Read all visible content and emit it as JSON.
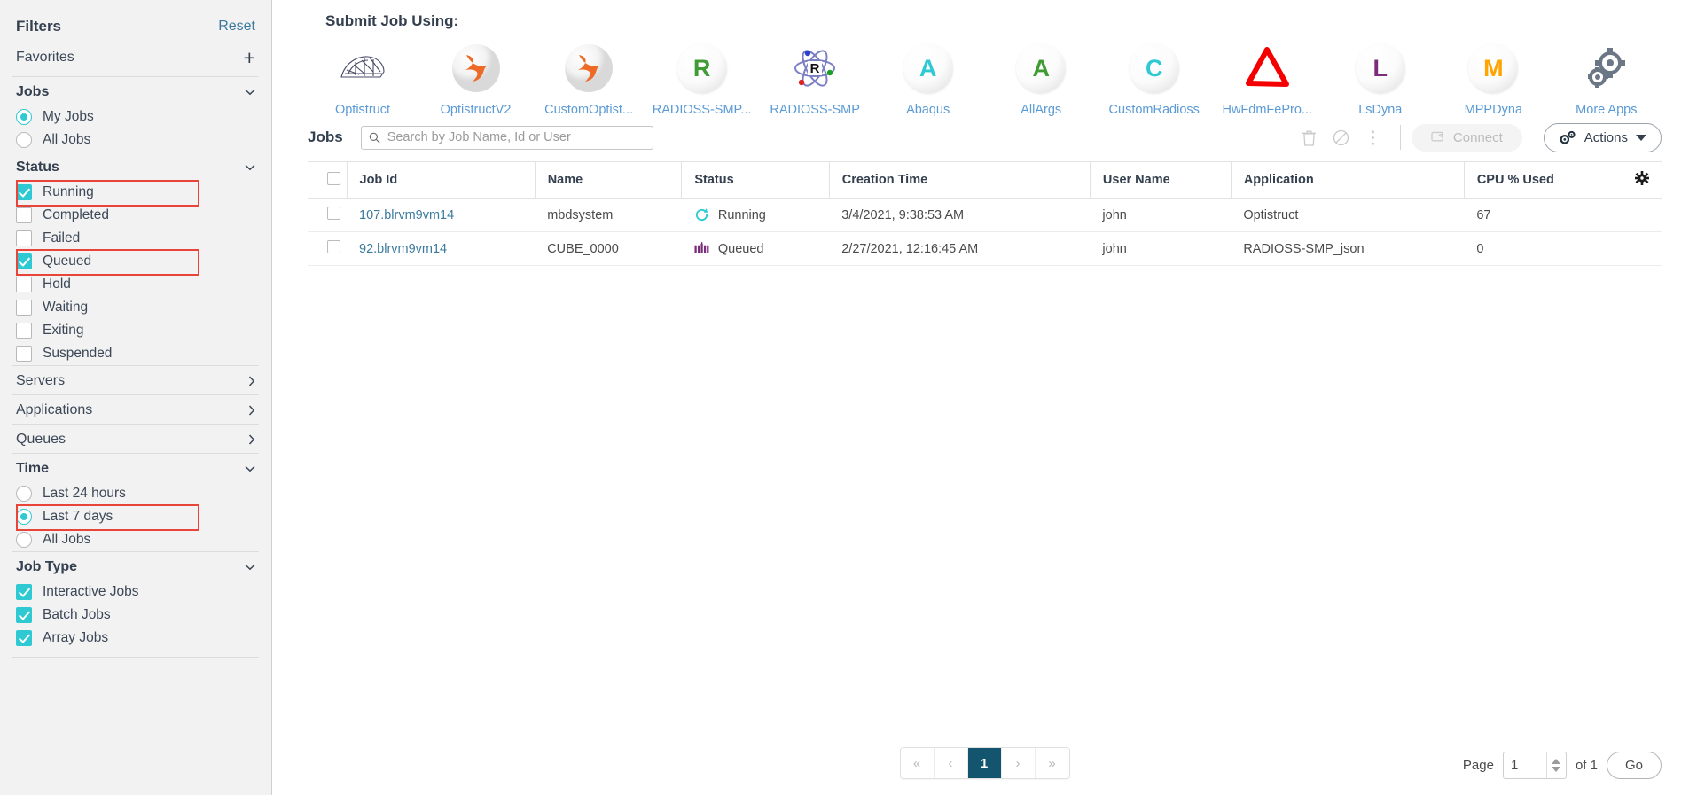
{
  "sidebar": {
    "title": "Filters",
    "reset_label": "Reset",
    "favorites_label": "Favorites",
    "add_icon": "plus-icon",
    "sections": [
      {
        "title": "Jobs",
        "type": "radio",
        "expanded": true,
        "options": [
          {
            "label": "My Jobs",
            "selected": true
          },
          {
            "label": "All Jobs",
            "selected": false
          }
        ]
      },
      {
        "title": "Status",
        "type": "checkbox",
        "expanded": true,
        "options": [
          {
            "label": "Running",
            "checked": true,
            "highlighted": true
          },
          {
            "label": "Completed",
            "checked": false,
            "highlighted": false
          },
          {
            "label": "Failed",
            "checked": false,
            "highlighted": false
          },
          {
            "label": "Queued",
            "checked": true,
            "highlighted": true
          },
          {
            "label": "Hold",
            "checked": false,
            "highlighted": false
          },
          {
            "label": "Waiting",
            "checked": false,
            "highlighted": false
          },
          {
            "label": "Exiting",
            "checked": false,
            "highlighted": false
          },
          {
            "label": "Suspended",
            "checked": false,
            "highlighted": false
          }
        ]
      },
      {
        "title": "Servers",
        "type": "collapsed",
        "expanded": false,
        "options": []
      },
      {
        "title": "Applications",
        "type": "collapsed",
        "expanded": false,
        "options": []
      },
      {
        "title": "Queues",
        "type": "collapsed",
        "expanded": false,
        "options": []
      },
      {
        "title": "Time",
        "type": "radio",
        "expanded": true,
        "options": [
          {
            "label": "Last 24 hours",
            "selected": false,
            "highlighted": false
          },
          {
            "label": "Last 7 days",
            "selected": true,
            "highlighted": true
          },
          {
            "label": "All Jobs",
            "selected": false,
            "highlighted": false
          }
        ]
      },
      {
        "title": "Job Type",
        "type": "checkbox",
        "expanded": true,
        "options": [
          {
            "label": "Interactive Jobs",
            "checked": true,
            "highlighted": false
          },
          {
            "label": "Batch Jobs",
            "checked": true,
            "highlighted": false
          },
          {
            "label": "Array Jobs",
            "checked": true,
            "highlighted": false
          }
        ]
      }
    ]
  },
  "submit": {
    "title": "Submit Job Using:",
    "apps": [
      {
        "label": "Optistruct",
        "icon": "mesh-structure-icon",
        "kind": "mesh",
        "color": "#4a4a6a"
      },
      {
        "label": "OptistructV2",
        "icon": "altair-h-icon",
        "kind": "altair",
        "color": "#ed6b26"
      },
      {
        "label": "CustomOptist...",
        "icon": "altair-h-icon",
        "kind": "altair",
        "color": "#ed6b26"
      },
      {
        "label": "RADIOSS-SMP...",
        "icon": "letter-r-icon",
        "kind": "letter",
        "color": "#3f9c35",
        "glyph": "R"
      },
      {
        "label": "RADIOSS-SMP",
        "icon": "atom-r-icon",
        "kind": "atom",
        "color": "#7b7fc4",
        "glyph": "R"
      },
      {
        "label": "Abaqus",
        "icon": "letter-a-icon",
        "kind": "letter",
        "color": "#2ec9d3",
        "glyph": "A"
      },
      {
        "label": "AllArgs",
        "icon": "letter-a-icon",
        "kind": "letter",
        "color": "#3f9c35",
        "glyph": "A"
      },
      {
        "label": "CustomRadioss",
        "icon": "letter-c-icon",
        "kind": "letter",
        "color": "#2ec9d3",
        "glyph": "C"
      },
      {
        "label": "HwFdmFePro...",
        "icon": "red-triangle-icon",
        "kind": "triangle",
        "color": "#f40000"
      },
      {
        "label": "LsDyna",
        "icon": "letter-l-icon",
        "kind": "letter",
        "color": "#7b2d7b",
        "glyph": "L"
      },
      {
        "label": "MPPDyna",
        "icon": "letter-m-icon",
        "kind": "letter",
        "color": "#ffa400",
        "glyph": "M"
      },
      {
        "label": "More Apps",
        "icon": "gears-icon",
        "kind": "gears",
        "color": "#6b7785"
      }
    ]
  },
  "jobs_panel": {
    "heading": "Jobs",
    "search_placeholder": "Search by Job Name, Id or User",
    "search_value": "",
    "toolbar": {
      "delete_icon": "trash-icon",
      "cancel_icon": "ban-icon",
      "more_icon": "kebab-menu-icon",
      "connect_label": "Connect",
      "connect_icon": "monitor-connect-icon",
      "connect_disabled": true,
      "actions_label": "Actions",
      "actions_icon": "gears-icon",
      "actions_caret": "chevron-down-icon"
    },
    "columns": [
      "Job Id",
      "Name",
      "Status",
      "Creation Time",
      "User Name",
      "Application",
      "CPU % Used"
    ],
    "settings_icon": "gear-icon",
    "rows": [
      {
        "selected": false,
        "job_id": "107.blrvm9vm14",
        "name": "mbdsystem",
        "status": "Running",
        "status_icon": "spinner-running-icon",
        "status_color": "#2ec9d3",
        "creation_time": "3/4/2021, 9:38:53 AM",
        "user_name": "john",
        "application": "Optistruct",
        "cpu_percent": "67"
      },
      {
        "selected": false,
        "job_id": "92.blrvm9vm14",
        "name": "CUBE_0000",
        "status": "Queued",
        "status_icon": "queue-bars-icon",
        "status_color": "#7b2d7b",
        "creation_time": "2/27/2021, 12:16:45 AM",
        "user_name": "john",
        "application": "RADIOSS-SMP_json",
        "cpu_percent": "0"
      }
    ]
  },
  "pagination": {
    "first_label": "«",
    "prev_label": "‹",
    "pages": [
      "1"
    ],
    "active_page": "1",
    "next_label": "›",
    "last_label": "»",
    "page_label": "Page",
    "page_value": "1",
    "of_label": "of 1",
    "go_label": "Go",
    "active_color": "#13556e"
  }
}
